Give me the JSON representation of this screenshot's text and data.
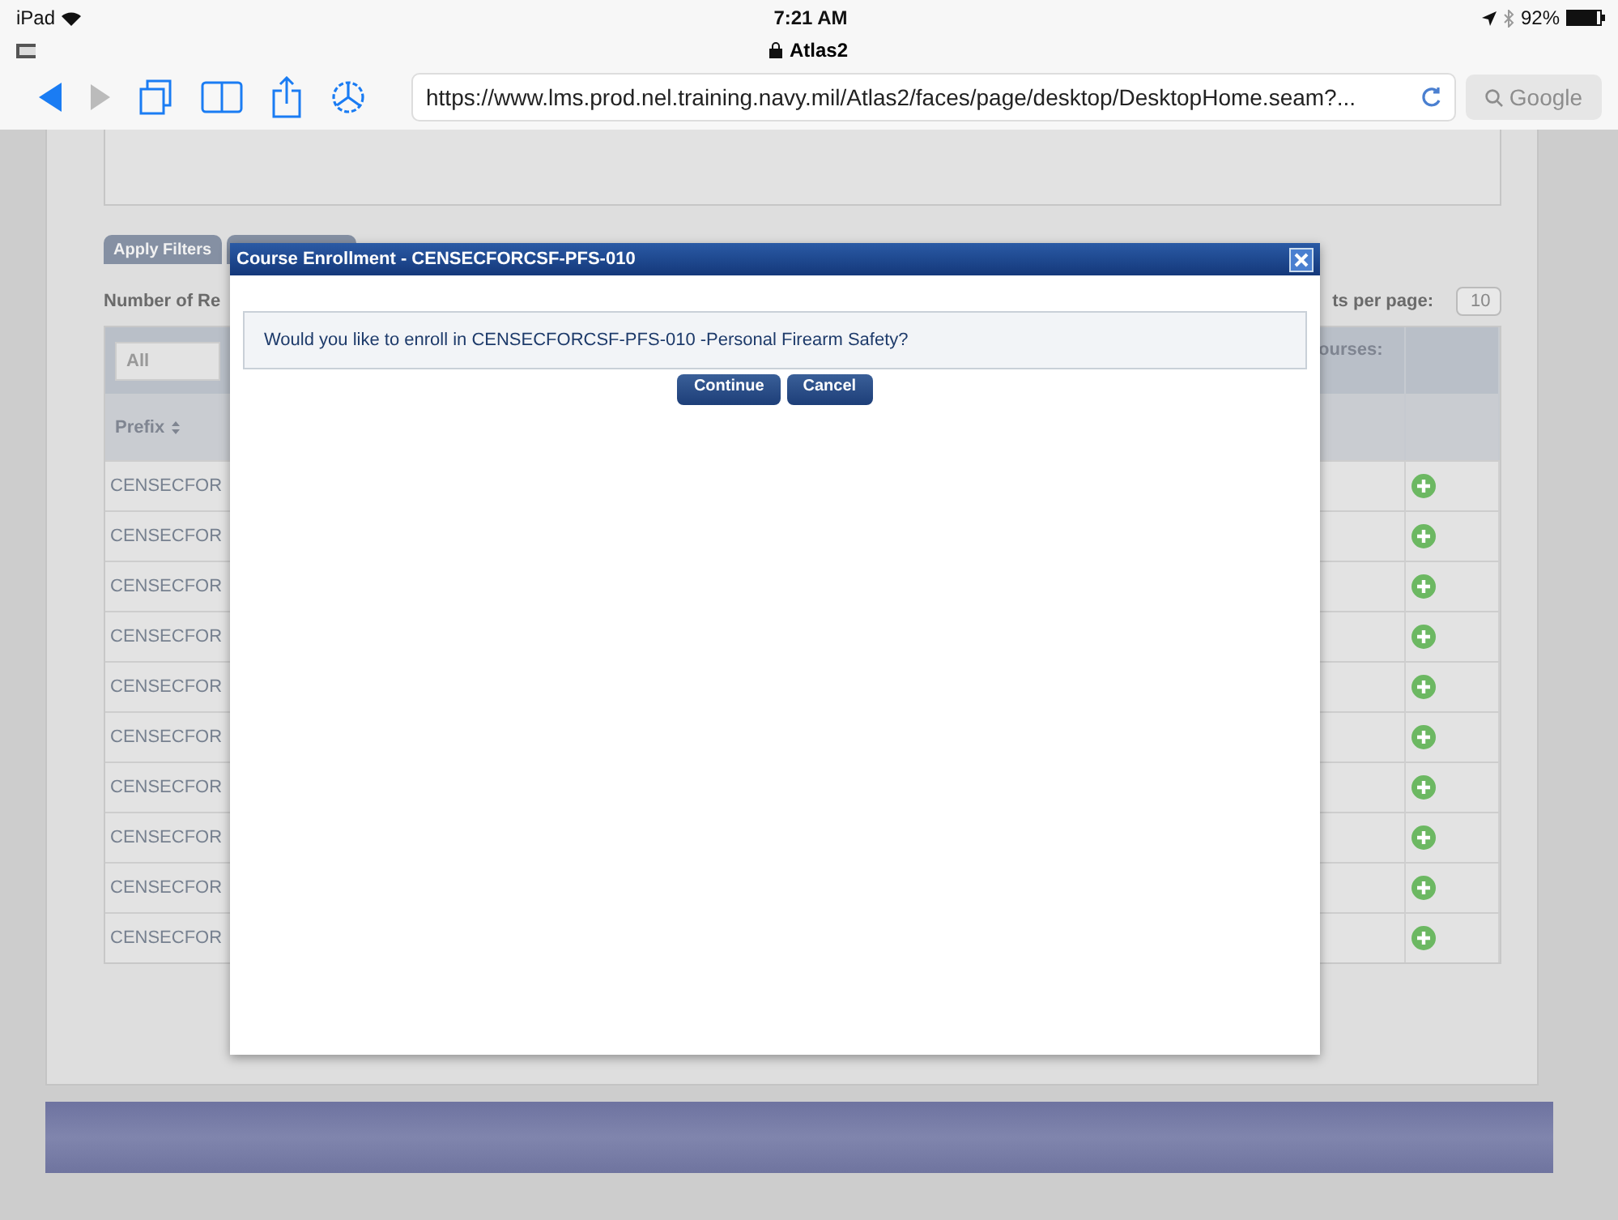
{
  "status_bar": {
    "carrier": "iPad",
    "time": "7:21 AM",
    "battery": "92%"
  },
  "browser": {
    "page_title": "Atlas2",
    "url": "https://www.lms.prod.nel.training.navy.mil/Atlas2/faces/page/desktop/DesktopHome.seam?...",
    "search_placeholder": "Google"
  },
  "page": {
    "apply_button": "Apply Filters",
    "records_label": "Number of Re",
    "per_page_label": "ts per page:",
    "per_page_value": "10",
    "filter_value": "All",
    "courses_label": "ourses:",
    "prefix_header": "Prefix",
    "rows": [
      {
        "prefix": "CENSECFOR"
      },
      {
        "prefix": "CENSECFOR"
      },
      {
        "prefix": "CENSECFOR"
      },
      {
        "prefix": "CENSECFOR"
      },
      {
        "prefix": "CENSECFOR"
      },
      {
        "prefix": "CENSECFOR"
      },
      {
        "prefix": "CENSECFOR"
      },
      {
        "prefix": "CENSECFOR"
      },
      {
        "prefix": "CENSECFOR"
      },
      {
        "prefix": "CENSECFOR"
      }
    ]
  },
  "dialog": {
    "title": "Course Enrollment - CENSECFORCSF-PFS-010",
    "message": "Would you like to enroll in CENSECFORCSF-PFS-010 -Personal Firearm Safety?",
    "buttons": [
      "Continue",
      "Cancel"
    ]
  }
}
